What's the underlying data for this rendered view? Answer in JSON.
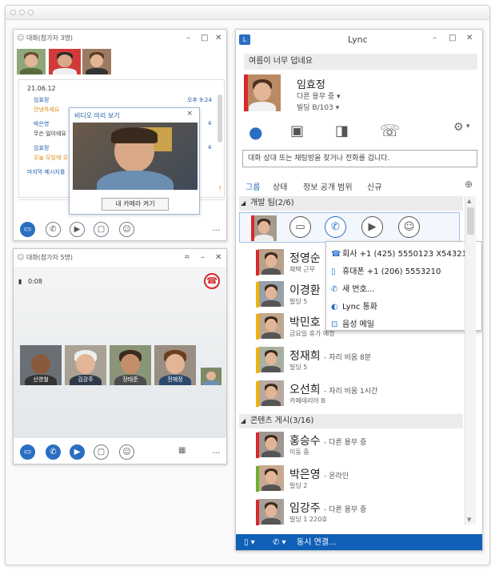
{
  "conv1": {
    "title": "대화(참가자 3명)",
    "date": "21.06.12",
    "messages": [
      {
        "sender": "임효정",
        "text": "안녕하세요",
        "time": "오후 9:24"
      },
      {
        "sender": "박은영",
        "text": "무슨 일이에요",
        "time": "4"
      },
      {
        "sender": "임효정",
        "text": "오늘 모임에 오",
        "time": "4"
      }
    ],
    "last_msg": "마지막 메시지를"
  },
  "video_preview": {
    "title": "비디오 미리 보기",
    "button": "내 카메라 켜기"
  },
  "conv2": {
    "title": "대화(참가자 5명)",
    "timer": "0:08",
    "participants": [
      "신영철",
      "김강주",
      "장태준",
      "전혜정"
    ]
  },
  "lync": {
    "title": "Lync",
    "status_note": "여름이 너무 덥네요",
    "user_name": "임효정",
    "user_status": "다른 용무 중",
    "user_location": "빌딩 B/103",
    "search_placeholder": "대화 상대 또는 채팅방을 찾거나 전화를 겁니다.",
    "tabs": [
      "그룹",
      "상태",
      "정보 공개 범위",
      "신규"
    ],
    "group1": "개발 팀(2/6)",
    "group2": "콘텐츠 게시(3/16)",
    "contacts": [
      {
        "name": "정영순",
        "sub": "채택 근무",
        "presence": "#d9282b"
      },
      {
        "name": "이경환",
        "sub": "빌딩 5",
        "presence": "#f2b400"
      },
      {
        "name": "박민호",
        "sub": "금요일 휴가 예정",
        "presence": "#f2b400"
      },
      {
        "name": "정재희",
        "status": "- 자리 비움 8분",
        "sub": "빌딩 5",
        "presence": "#f2b400"
      },
      {
        "name": "오선희",
        "status": "- 자리 비움 1시간",
        "sub": "카페테리아 B",
        "presence": "#f2b400"
      },
      {
        "name": "홍승수",
        "status": "- 다른 용무 중",
        "sub": "이동 중",
        "presence": "#d9282b"
      },
      {
        "name": "박은영",
        "status": "- 온라인",
        "sub": "빌딩 2",
        "presence": "#6bb22e"
      },
      {
        "name": "임강주",
        "status": "- 다른 용무 중",
        "sub": "빌딩 1 220호",
        "presence": "#d9282b"
      }
    ],
    "call_menu": [
      {
        "icon": "office-phone-icon",
        "label": "회사 +1 (425) 5550123 X54321"
      },
      {
        "icon": "mobile-phone-icon",
        "label": "휴대폰 +1 (206) 5553210"
      },
      {
        "icon": "new-number-icon",
        "label": "새 번호..."
      },
      {
        "icon": "lync-call-icon",
        "label": "Lync 통화"
      },
      {
        "icon": "voicemail-icon",
        "label": "음성 메일"
      }
    ],
    "bottom_action": "동시 연결..."
  },
  "colors": {
    "accent": "#2a6ec2",
    "busy": "#d9282b",
    "away": "#f2b400",
    "online": "#6bb22e",
    "bottom_bar": "#1060b8"
  }
}
